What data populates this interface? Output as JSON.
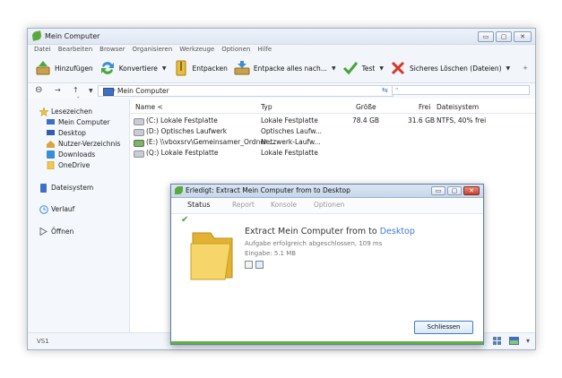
{
  "window": {
    "title": "Mein Computer",
    "min_glyph": "▭",
    "max_glyph": "▢",
    "close_glyph": "✕"
  },
  "menu": [
    "Datei",
    "Bearbeiten",
    "Browser",
    "Organisieren",
    "Werkzeuge",
    "Optionen",
    "Hilfe"
  ],
  "toolbar": {
    "add": "Hinzufügen",
    "convert": "Konvertiere",
    "extract": "Entpacken",
    "extract_to": "Entpacke alles nach...",
    "test": "Test",
    "secure_delete": "Sicheres Löschen (Dateien)",
    "dropdown_glyph": "▼",
    "overflow_glyph": "+"
  },
  "nav": {
    "back": "⊖",
    "forward": "→",
    "up": "↑",
    "dropdown": "▼",
    "refresh": "⇆",
    "sep": "›"
  },
  "address": {
    "path": "Mein Computer"
  },
  "search": {
    "value": "\""
  },
  "sidebar": {
    "arrow": "ˇ",
    "bookmarks_header": "Lesezeichen",
    "bookmarks": [
      "Mein Computer",
      "Desktop",
      "Nutzer-Verzeichnis",
      "Downloads",
      "OneDrive"
    ],
    "filesystem": "Dateisystem",
    "history": "Verlauf",
    "open": "Öffnen"
  },
  "columns": {
    "name": "Name <",
    "type": "Typ",
    "size": "Größe",
    "free": "Frei",
    "fs": "Dateisystem"
  },
  "rows": [
    {
      "name": "(C:) Lokale Festplatte",
      "type": "Lokale Festplatte",
      "size": "78.4 GB",
      "free": "31.6 GB",
      "fs": "NTFS, 40% frei"
    },
    {
      "name": "(D:) Optisches Laufwerk",
      "type": "Optisches Laufw...",
      "size": "",
      "free": "",
      "fs": ""
    },
    {
      "name": "(E:) \\\\vboxsrv\\Gemeinsamer_Ordner ...",
      "type": "Netzwerk-Laufw...",
      "size": "",
      "free": "",
      "fs": ""
    },
    {
      "name": "(Q:) Lokale Festplatte",
      "type": "Lokale Festplatte",
      "size": "",
      "free": "",
      "fs": ""
    }
  ],
  "status": {
    "left": "VS1",
    "overflow_glyph": "▾"
  },
  "dialog": {
    "title": "Erledigt: Extract Mein Computer from  to Desktop",
    "tabs": [
      "Status",
      "Report",
      "Konsole",
      "Optionen"
    ],
    "check_glyph": "✔",
    "headline_prefix": "Extract Mein Computer from  to ",
    "headline_link": "Desktop",
    "line1": "Aufgabe erfolgreich abgeschlossen, 109 ms",
    "line2": "Eingabe: 5.1 MB",
    "close_button": "Schliessen"
  },
  "colors": {
    "accent": "#3d7bd1",
    "progress": "#5fb33f",
    "folder": "#f1c94d"
  }
}
